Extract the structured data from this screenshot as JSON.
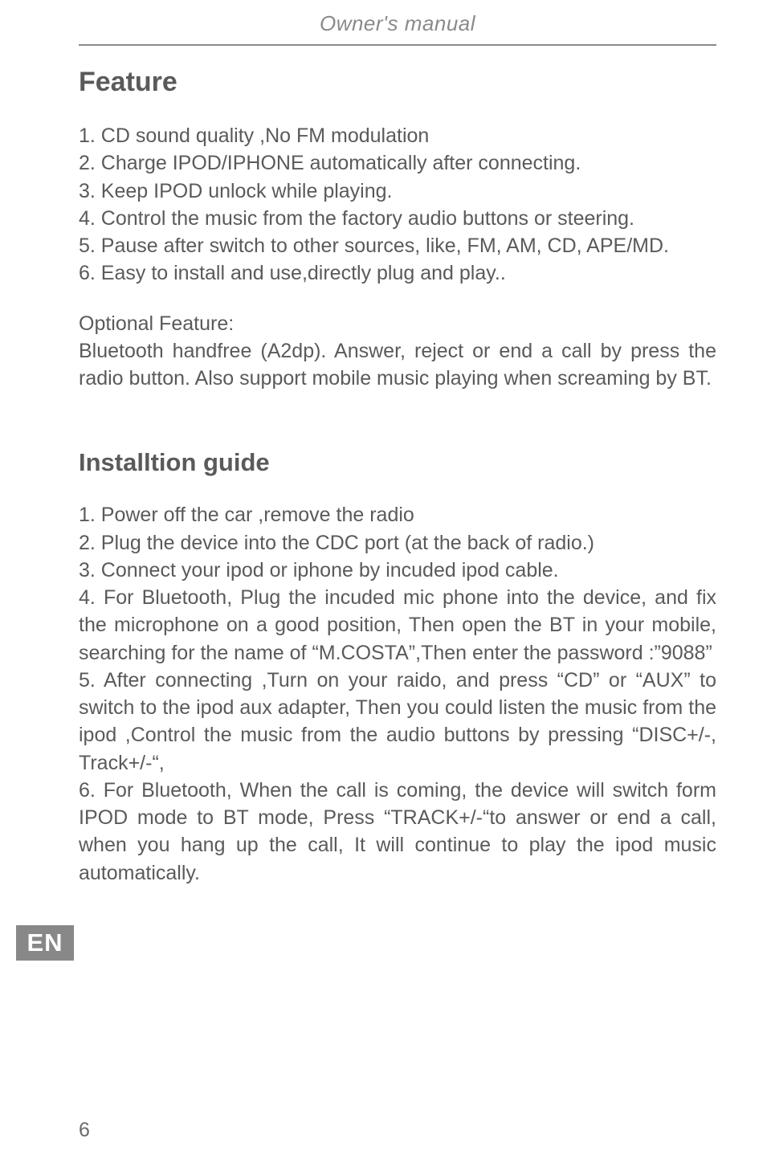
{
  "header": "Owner's manual",
  "feature_title": "Feature",
  "feature_items": [
    "1. CD sound quality ,No FM modulation",
    "2. Charge IPOD/IPHONE automatically after connecting.",
    "3. Keep IPOD unlock while playing.",
    "4. Control the music from the factory audio buttons or steering.",
    "5. Pause after switch to other sources, like, FM, AM, CD, APE/MD.",
    "6. Easy to install and use,directly plug and play.."
  ],
  "optional_title": "Optional Feature:",
  "optional_body": "Bluetooth handfree (A2dp). Answer, reject or end a call by press the radio button. Also support mobile music playing when screaming by BT.",
  "install_title": "Installtion guide",
  "install_items": [
    "1. Power off the car ,remove the radio",
    "2. Plug the device into the CDC port (at the back of radio.)",
    "3. Connect your ipod or iphone by incuded ipod cable.",
    "4. For Bluetooth, Plug the incuded mic phone into the device, and fix the microphone on a good position, Then open the BT in your mobile, searching for the name of “M.COSTA”,Then enter the password :”9088”",
    "5. After connecting ,Turn on your raido, and press “CD” or “AUX” to switch to the ipod aux adapter, Then you could listen the music from the ipod ,Control the music from the audio buttons by pressing “DISC+/-, Track+/-“,",
    "6. For Bluetooth, When the call is coming, the device will switch form IPOD mode to BT mode, Press “TRACK+/-“to answer or end a call, when you hang up the call, It will continue to play the ipod music automatically."
  ],
  "lang_tab": "EN",
  "page_number": "6"
}
